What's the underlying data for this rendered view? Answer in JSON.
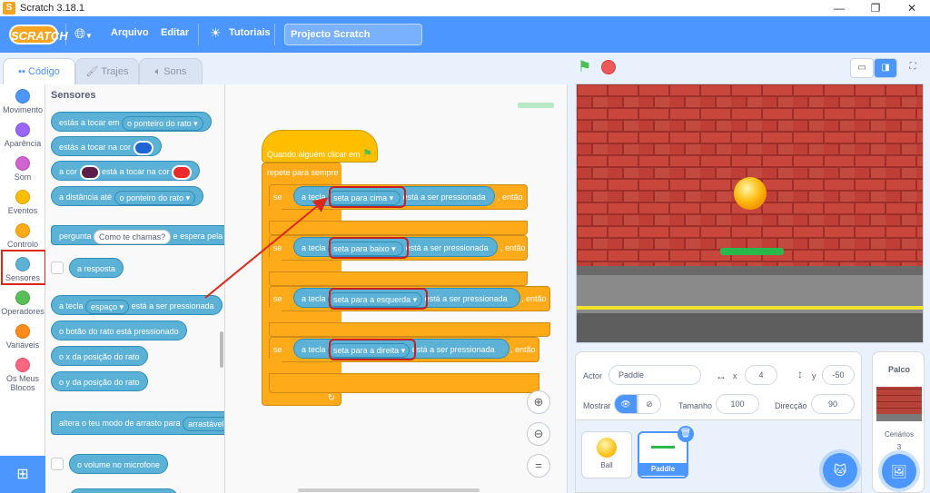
{
  "window": {
    "title": "Scratch 3.18.1",
    "logo_icon": "scratch-cat-icon"
  },
  "menubar": {
    "brand": "SCRATCH",
    "language_icon": "globe-icon",
    "file": "Arquivo",
    "edit": "Editar",
    "tutorials": "Tutoriais",
    "project_name": "Projecto Scratch"
  },
  "tabs": {
    "code": "Código",
    "costumes": "Trajes",
    "sounds": "Sons"
  },
  "categories": [
    {
      "label": "Movimento",
      "color": "#4c97ff"
    },
    {
      "label": "Aparência",
      "color": "#9966ff"
    },
    {
      "label": "Som",
      "color": "#cf63cf"
    },
    {
      "label": "Eventos",
      "color": "#ffbf00"
    },
    {
      "label": "Controlo",
      "color": "#ffab19"
    },
    {
      "label": "Sensores",
      "color": "#5cb1d6"
    },
    {
      "label": "Operadores",
      "color": "#59c059"
    },
    {
      "label": "Variáveis",
      "color": "#ff8c1a"
    },
    {
      "label": "Os Meus Blocos",
      "color": "#ff6680"
    }
  ],
  "palette": {
    "heading": "Sensores",
    "touching": "estás a tocar em",
    "touching_value": "o ponteiro do rato",
    "touching_color": "estás a tocar na cor",
    "color_a": "a cor",
    "color_touching": "está a tocar na cor",
    "distance": "a distância até",
    "distance_value": "o ponteiro do rato",
    "ask": "pergunta",
    "ask_value": "Como te chamas?",
    "ask_wait": "e espera pela re",
    "answer": "a resposta",
    "key": "a tecla",
    "key_value": "espaço",
    "key_pressed": "está a ser pressionada",
    "mouse_down": "o botão do rato está pressionado",
    "mouse_x": "o x da posição do rato",
    "mouse_y": "o y da posição do rato",
    "drag_mode": "altera o teu modo de arrasto para",
    "drag_value": "arrastável",
    "loudness": "o volume no microfone"
  },
  "script": {
    "hat": "Quando alguém clicar em",
    "forever": "repete para sempre",
    "if": "se",
    "then": ", então",
    "key": "a tecla",
    "pressed": "está a ser pressionada",
    "keys": [
      "seta para cima",
      "seta para baixo",
      "seta para a esquerda",
      "seta para a direita"
    ]
  },
  "stage": {
    "green_flag_icon": "green-flag-icon",
    "stop_icon": "stop-icon"
  },
  "sprite": {
    "actor_label": "Actor",
    "actor_name": "Paddle",
    "x_label": "x",
    "x": "4",
    "y_label": "y",
    "y": "-50",
    "show_label": "Mostrar",
    "size_label": "Tamanho",
    "size": "100",
    "direction_label": "Direcção",
    "direction": "90"
  },
  "sprites": [
    "Ball",
    "Paddle"
  ],
  "stage_panel": {
    "title": "Palco",
    "backdrops_label": "Cenários",
    "backdrops_count": "3"
  },
  "colors": {
    "menubar": "#4c97ff",
    "sensing": "#5cb1d6",
    "control": "#ffab19",
    "events": "#ffbf00",
    "highlight": "#c62020"
  }
}
